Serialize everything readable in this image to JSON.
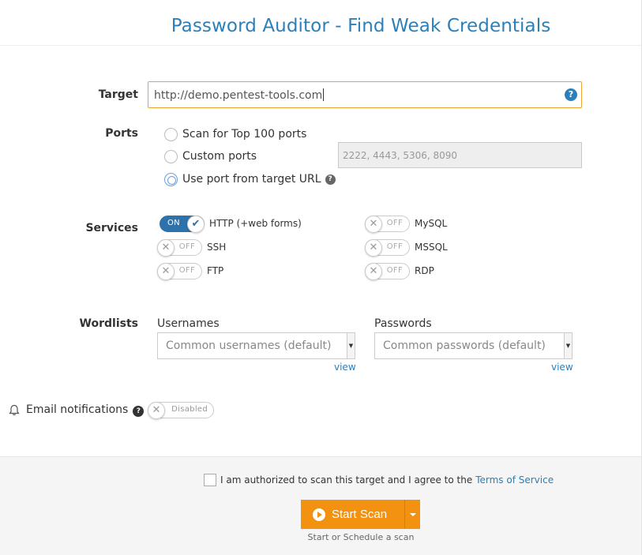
{
  "title": "Password Auditor - Find Weak Credentials",
  "target": {
    "label": "Target",
    "value": "http://demo.pentest-tools.com",
    "help": "?"
  },
  "ports": {
    "label": "Ports",
    "options": [
      {
        "label": "Scan for Top 100 ports",
        "checked": false
      },
      {
        "label": "Custom ports",
        "checked": false
      },
      {
        "label": "Use port from target URL",
        "checked": true
      }
    ],
    "custom_placeholder": "2222, 4443, 5306, 8090",
    "help": "?"
  },
  "services": {
    "label": "Services",
    "on_text": "ON",
    "off_text": "OFF",
    "items": [
      {
        "label": "HTTP (+web forms)",
        "enabled": true
      },
      {
        "label": "SSH",
        "enabled": false
      },
      {
        "label": "FTP",
        "enabled": false
      },
      {
        "label": "MySQL",
        "enabled": false
      },
      {
        "label": "MSSQL",
        "enabled": false
      },
      {
        "label": "RDP",
        "enabled": false
      }
    ]
  },
  "wordlists": {
    "label": "Wordlists",
    "usernames_label": "Usernames",
    "usernames_value": "Common usernames (default)",
    "passwords_label": "Passwords",
    "passwords_value": "Common passwords (default)",
    "view_label": "view"
  },
  "email": {
    "label": "Email notifications",
    "toggle_text": "Disabled",
    "help": "?"
  },
  "footer": {
    "agree_text": "I am authorized to scan this target and I agree to the",
    "tos_link": "Terms of Service",
    "scan_button": "Start Scan",
    "scan_sub": "Start or Schedule a scan"
  },
  "colors": {
    "accent": "#2c7fb8",
    "button": "#f39210",
    "toggle_on": "#2e72ab"
  }
}
